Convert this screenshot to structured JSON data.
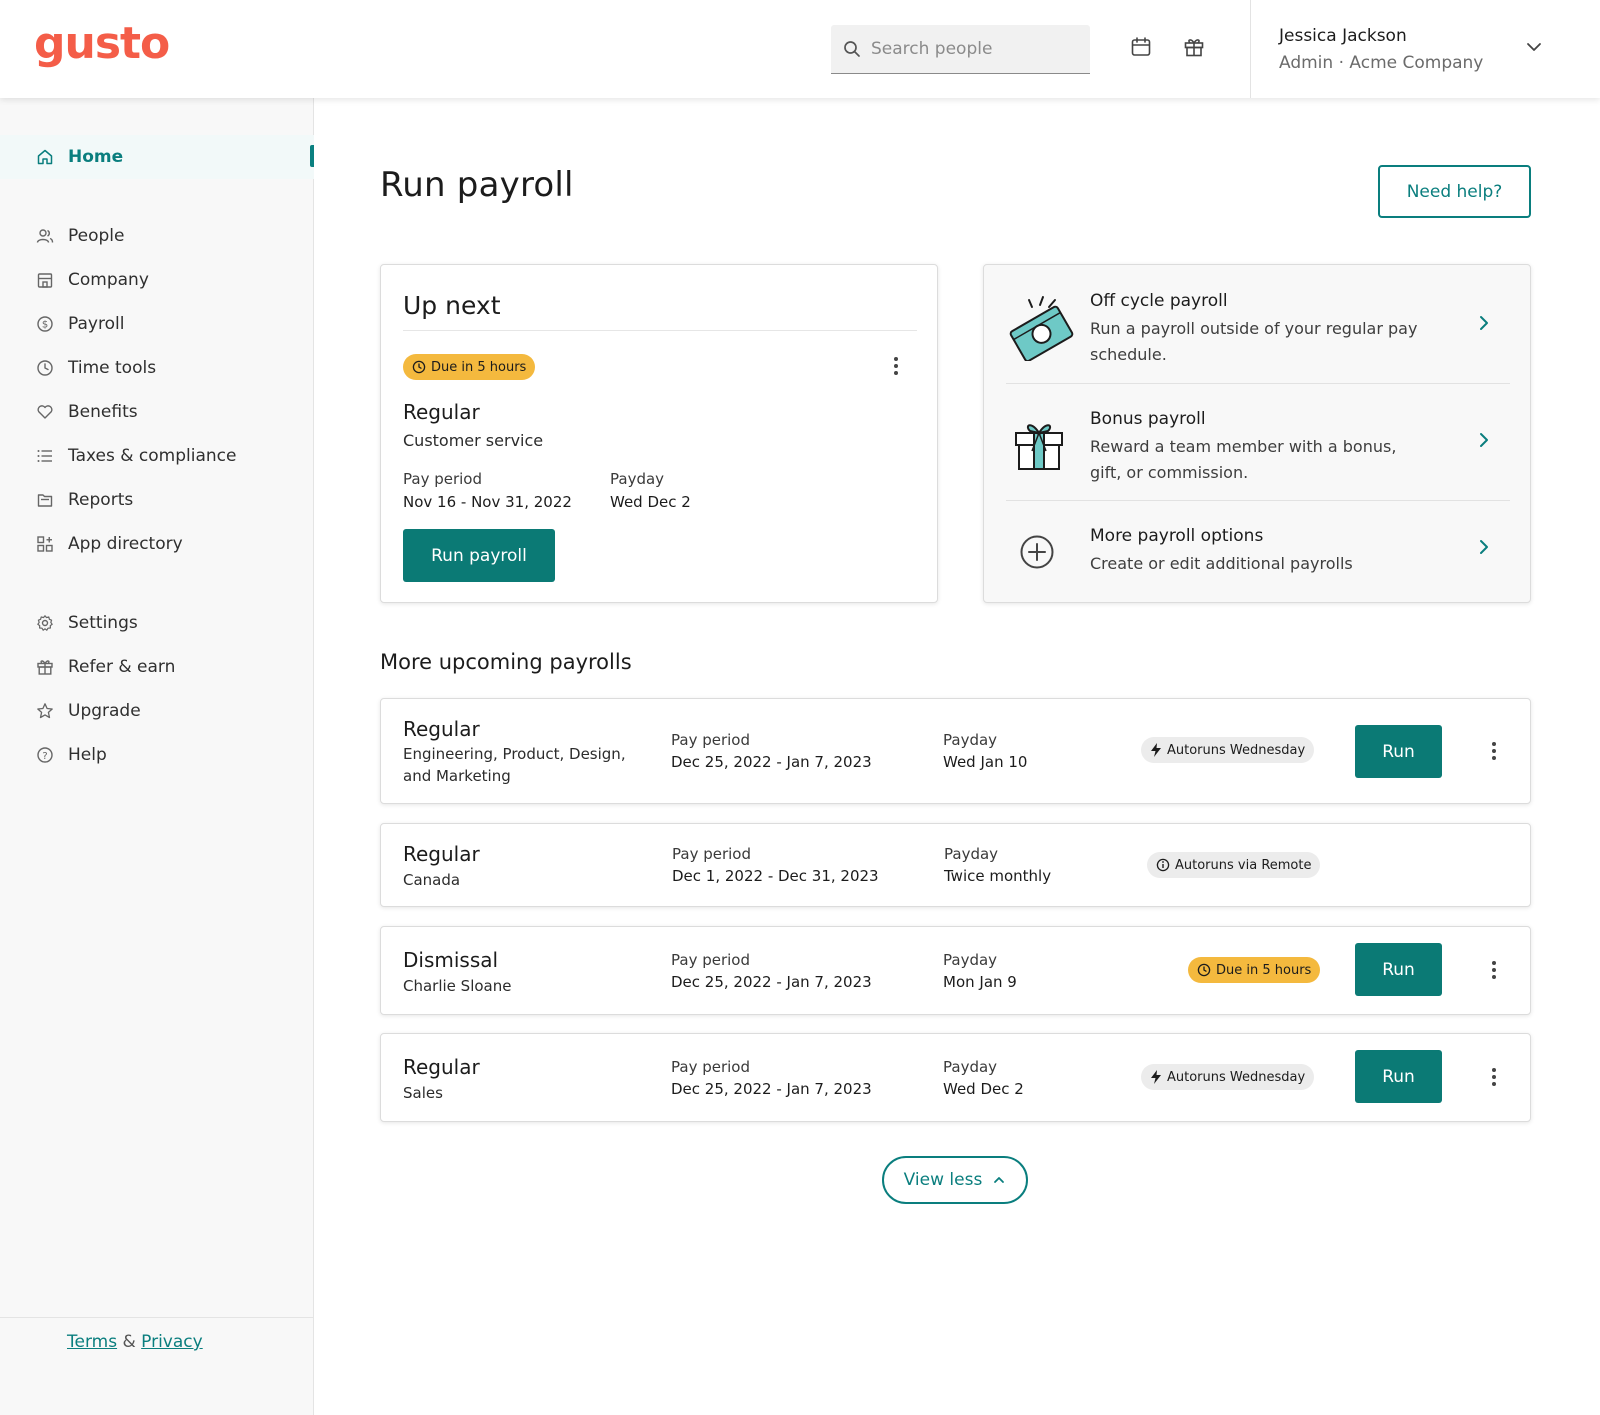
{
  "brand": {
    "logo_text": "gusto",
    "logo_color": "#f45d48",
    "accent": "#0b7a75"
  },
  "header": {
    "search_placeholder": "Search people",
    "user_name": "Jessica Jackson",
    "user_role": "Admin · Acme Company",
    "icons": [
      "calendar-icon",
      "gift-icon",
      "chevron-down-icon"
    ]
  },
  "sidebar": {
    "items": [
      {
        "label": "Home",
        "icon": "home-icon",
        "active": true
      },
      {
        "label": "People",
        "icon": "people-icon"
      },
      {
        "label": "Company",
        "icon": "company-icon"
      },
      {
        "label": "Payroll",
        "icon": "payroll-icon"
      },
      {
        "label": "Time tools",
        "icon": "clock-icon"
      },
      {
        "label": "Benefits",
        "icon": "heart-icon"
      },
      {
        "label": "Taxes & compliance",
        "icon": "list-icon"
      },
      {
        "label": "Reports",
        "icon": "folder-icon"
      },
      {
        "label": "App directory",
        "icon": "apps-icon"
      },
      {
        "label": "Settings",
        "icon": "gear-icon"
      },
      {
        "label": "Refer & earn",
        "icon": "gift-icon"
      },
      {
        "label": "Upgrade",
        "icon": "star-icon"
      },
      {
        "label": "Help",
        "icon": "help-icon"
      }
    ],
    "legal": {
      "terms": "Terms",
      "amp": "&",
      "privacy": "Privacy"
    }
  },
  "main": {
    "title": "Run payroll",
    "help_button": "Need help?",
    "up_next": {
      "title": "Up next",
      "badge": "Due in 5 hours",
      "type": "Regular",
      "group": "Customer service",
      "pay_period_label": "Pay period",
      "pay_period": "Nov 16 - Nov 31, 2022",
      "payday_label": "Payday",
      "payday": "Wed Dec 2",
      "run_button": "Run payroll"
    },
    "options": [
      {
        "title": "Off cycle payroll",
        "desc": "Run a payroll outside of your regular pay schedule.",
        "icon": "off-cycle-illustration"
      },
      {
        "title": "Bonus payroll",
        "desc": "Reward a team member with a bonus, gift, or commission.",
        "icon": "bonus-gift-illustration"
      },
      {
        "title": "More payroll options",
        "desc": "Create or edit additional payrolls",
        "icon": "plus-circle-icon"
      }
    ],
    "upcoming_title": "More upcoming payrolls",
    "upcoming": [
      {
        "type": "Regular",
        "group": "Engineering, Product, Design, and Marketing",
        "pay_period_label": "Pay period",
        "pay_period": "Dec 25, 2022 - Jan 7, 2023",
        "payday_label": "Payday",
        "payday": "Wed Jan 10",
        "badge": "Autoruns Wednesday",
        "badge_kind": "autorun",
        "run": "Run"
      },
      {
        "type": "Regular",
        "group": "Canada",
        "pay_period_label": "Pay period",
        "pay_period": "Dec 1, 2022 - Dec 31, 2023",
        "payday_label": "Payday",
        "payday": "Twice monthly",
        "badge": "Autoruns via Remote",
        "badge_kind": "remote"
      },
      {
        "type": "Dismissal",
        "group": "Charlie Sloane",
        "pay_period_label": "Pay period",
        "pay_period": "Dec 25, 2022 - Jan 7, 2023",
        "payday_label": "Payday",
        "payday": "Mon Jan 9",
        "badge": "Due in 5 hours",
        "badge_kind": "due",
        "run": "Run"
      },
      {
        "type": "Regular",
        "group": "Sales",
        "pay_period_label": "Pay period",
        "pay_period": "Dec 25, 2022 - Jan 7, 2023",
        "payday_label": "Payday",
        "payday": "Wed Dec 2",
        "badge": "Autoruns Wednesday",
        "badge_kind": "autorun",
        "run": "Run"
      }
    ],
    "view_less": "View less"
  }
}
